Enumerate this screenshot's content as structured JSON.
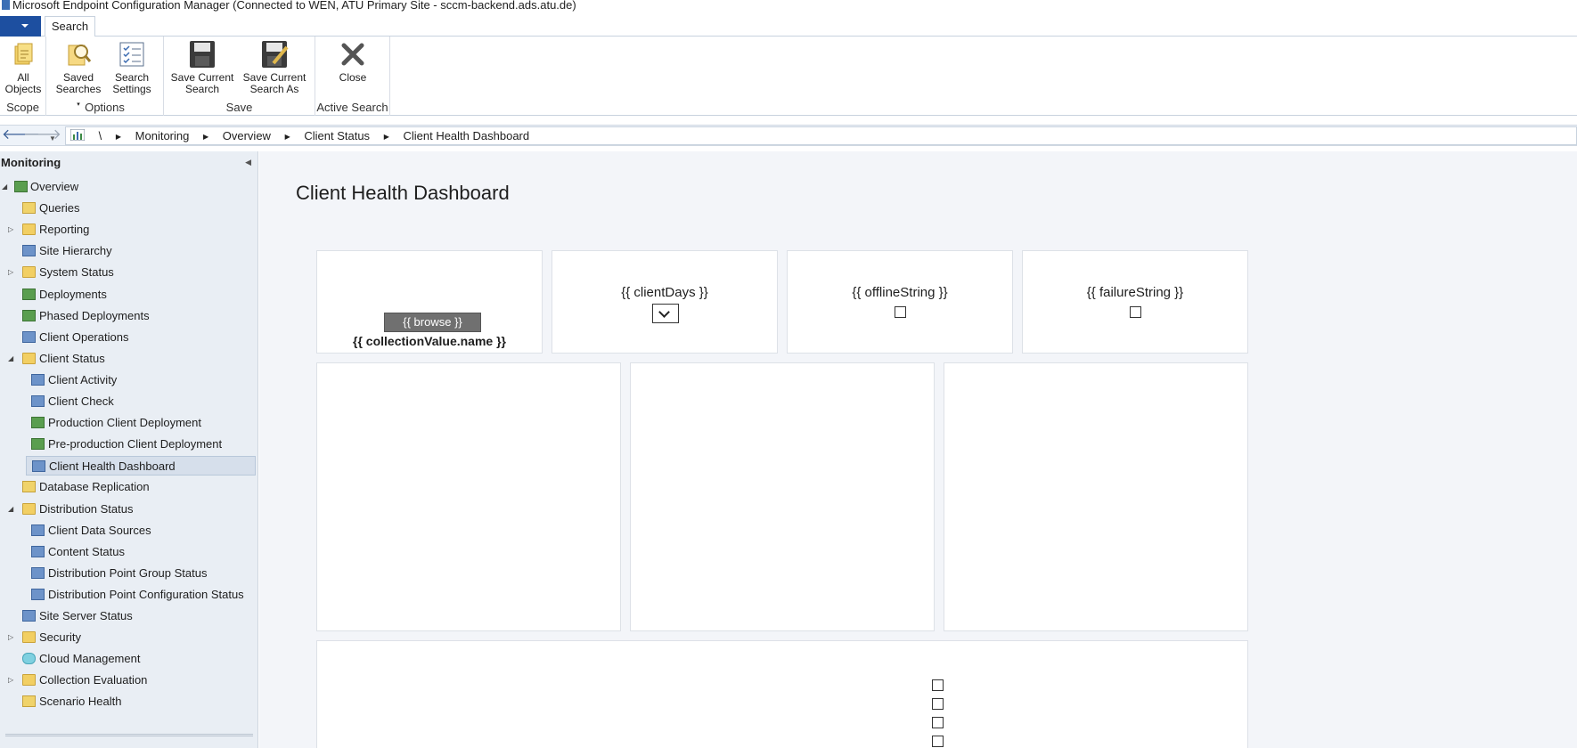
{
  "window": {
    "title": "Microsoft Endpoint Configuration Manager (Connected to WEN, ATU Primary Site - sccm-backend.ads.atu.de)"
  },
  "ribbon": {
    "tabs": [
      {
        "label": "Search"
      }
    ],
    "groups": {
      "scope": {
        "label": "Scope",
        "all_objects": "All\nObjects"
      },
      "options": {
        "label": "Options",
        "saved_searches": "Saved\nSearches",
        "search_settings": "Search\nSettings"
      },
      "save": {
        "label": "Save",
        "save_current_search": "Save Current\nSearch",
        "save_current_search_as": "Save Current\nSearch As"
      },
      "active_search": {
        "label": "Active Search",
        "close": "Close"
      }
    }
  },
  "navbar": {
    "root": "\\",
    "crumbs": [
      "Monitoring",
      "Overview",
      "Client Status",
      "Client Health Dashboard"
    ]
  },
  "leftpanel": {
    "header": "Monitoring",
    "items": [
      {
        "label": "Overview",
        "level": 0,
        "expand": "collapse",
        "icon": "overview-icon"
      },
      {
        "label": "Queries",
        "level": 1,
        "expand": "",
        "icon": "queries-icon"
      },
      {
        "label": "Reporting",
        "level": 1,
        "expand": "expand",
        "icon": "folder-icon"
      },
      {
        "label": "Site Hierarchy",
        "level": 1,
        "expand": "",
        "icon": "site-hierarchy-icon"
      },
      {
        "label": "System Status",
        "level": 1,
        "expand": "expand",
        "icon": "folder-icon"
      },
      {
        "label": "Deployments",
        "level": 1,
        "expand": "",
        "icon": "deployments-icon"
      },
      {
        "label": "Phased Deployments",
        "level": 1,
        "expand": "",
        "icon": "phased-deployments-icon"
      },
      {
        "label": "Client Operations",
        "level": 1,
        "expand": "",
        "icon": "client-operations-icon"
      },
      {
        "label": "Client Status",
        "level": 1,
        "expand": "collapse",
        "icon": "folder-icon"
      },
      {
        "label": "Client Activity",
        "level": 2,
        "expand": "",
        "icon": "client-activity-icon"
      },
      {
        "label": "Client Check",
        "level": 2,
        "expand": "",
        "icon": "client-check-icon"
      },
      {
        "label": "Production Client Deployment",
        "level": 2,
        "expand": "",
        "icon": "production-deployment-icon"
      },
      {
        "label": "Pre-production Client Deployment",
        "level": 2,
        "expand": "",
        "icon": "preproduction-deployment-icon"
      },
      {
        "label": "Client Health Dashboard",
        "level": 2,
        "expand": "",
        "icon": "dashboard-icon",
        "selected": true
      },
      {
        "label": "Database Replication",
        "level": 1,
        "expand": "",
        "icon": "database-replication-icon"
      },
      {
        "label": "Distribution Status",
        "level": 1,
        "expand": "collapse",
        "icon": "folder-icon"
      },
      {
        "label": "Client Data Sources",
        "level": 2,
        "expand": "",
        "icon": "client-data-sources-icon"
      },
      {
        "label": "Content Status",
        "level": 2,
        "expand": "",
        "icon": "content-status-icon"
      },
      {
        "label": "Distribution Point Group Status",
        "level": 2,
        "expand": "",
        "icon": "dp-group-status-icon"
      },
      {
        "label": "Distribution Point Configuration Status",
        "level": 2,
        "expand": "",
        "icon": "dp-config-status-icon"
      },
      {
        "label": "Site Server Status",
        "level": 1,
        "expand": "",
        "icon": "site-server-status-icon"
      },
      {
        "label": "Security",
        "level": 1,
        "expand": "expand",
        "icon": "folder-icon"
      },
      {
        "label": "Cloud Management",
        "level": 1,
        "expand": "",
        "icon": "cloud-icon"
      },
      {
        "label": "Collection Evaluation",
        "level": 1,
        "expand": "expand",
        "icon": "folder-icon"
      },
      {
        "label": "Scenario Health",
        "level": 1,
        "expand": "",
        "icon": "scenario-health-icon"
      }
    ]
  },
  "main": {
    "title": "Client Health Dashboard",
    "collection_card": {
      "browse": "{{ browse }}",
      "collection_name": "{{ collectionValue.name }}"
    },
    "client_days_card": {
      "label": "{{ clientDays }}"
    },
    "offline_card": {
      "label": "{{ offlineString }}"
    },
    "failure_card": {
      "label": "{{ failureString }}"
    }
  }
}
